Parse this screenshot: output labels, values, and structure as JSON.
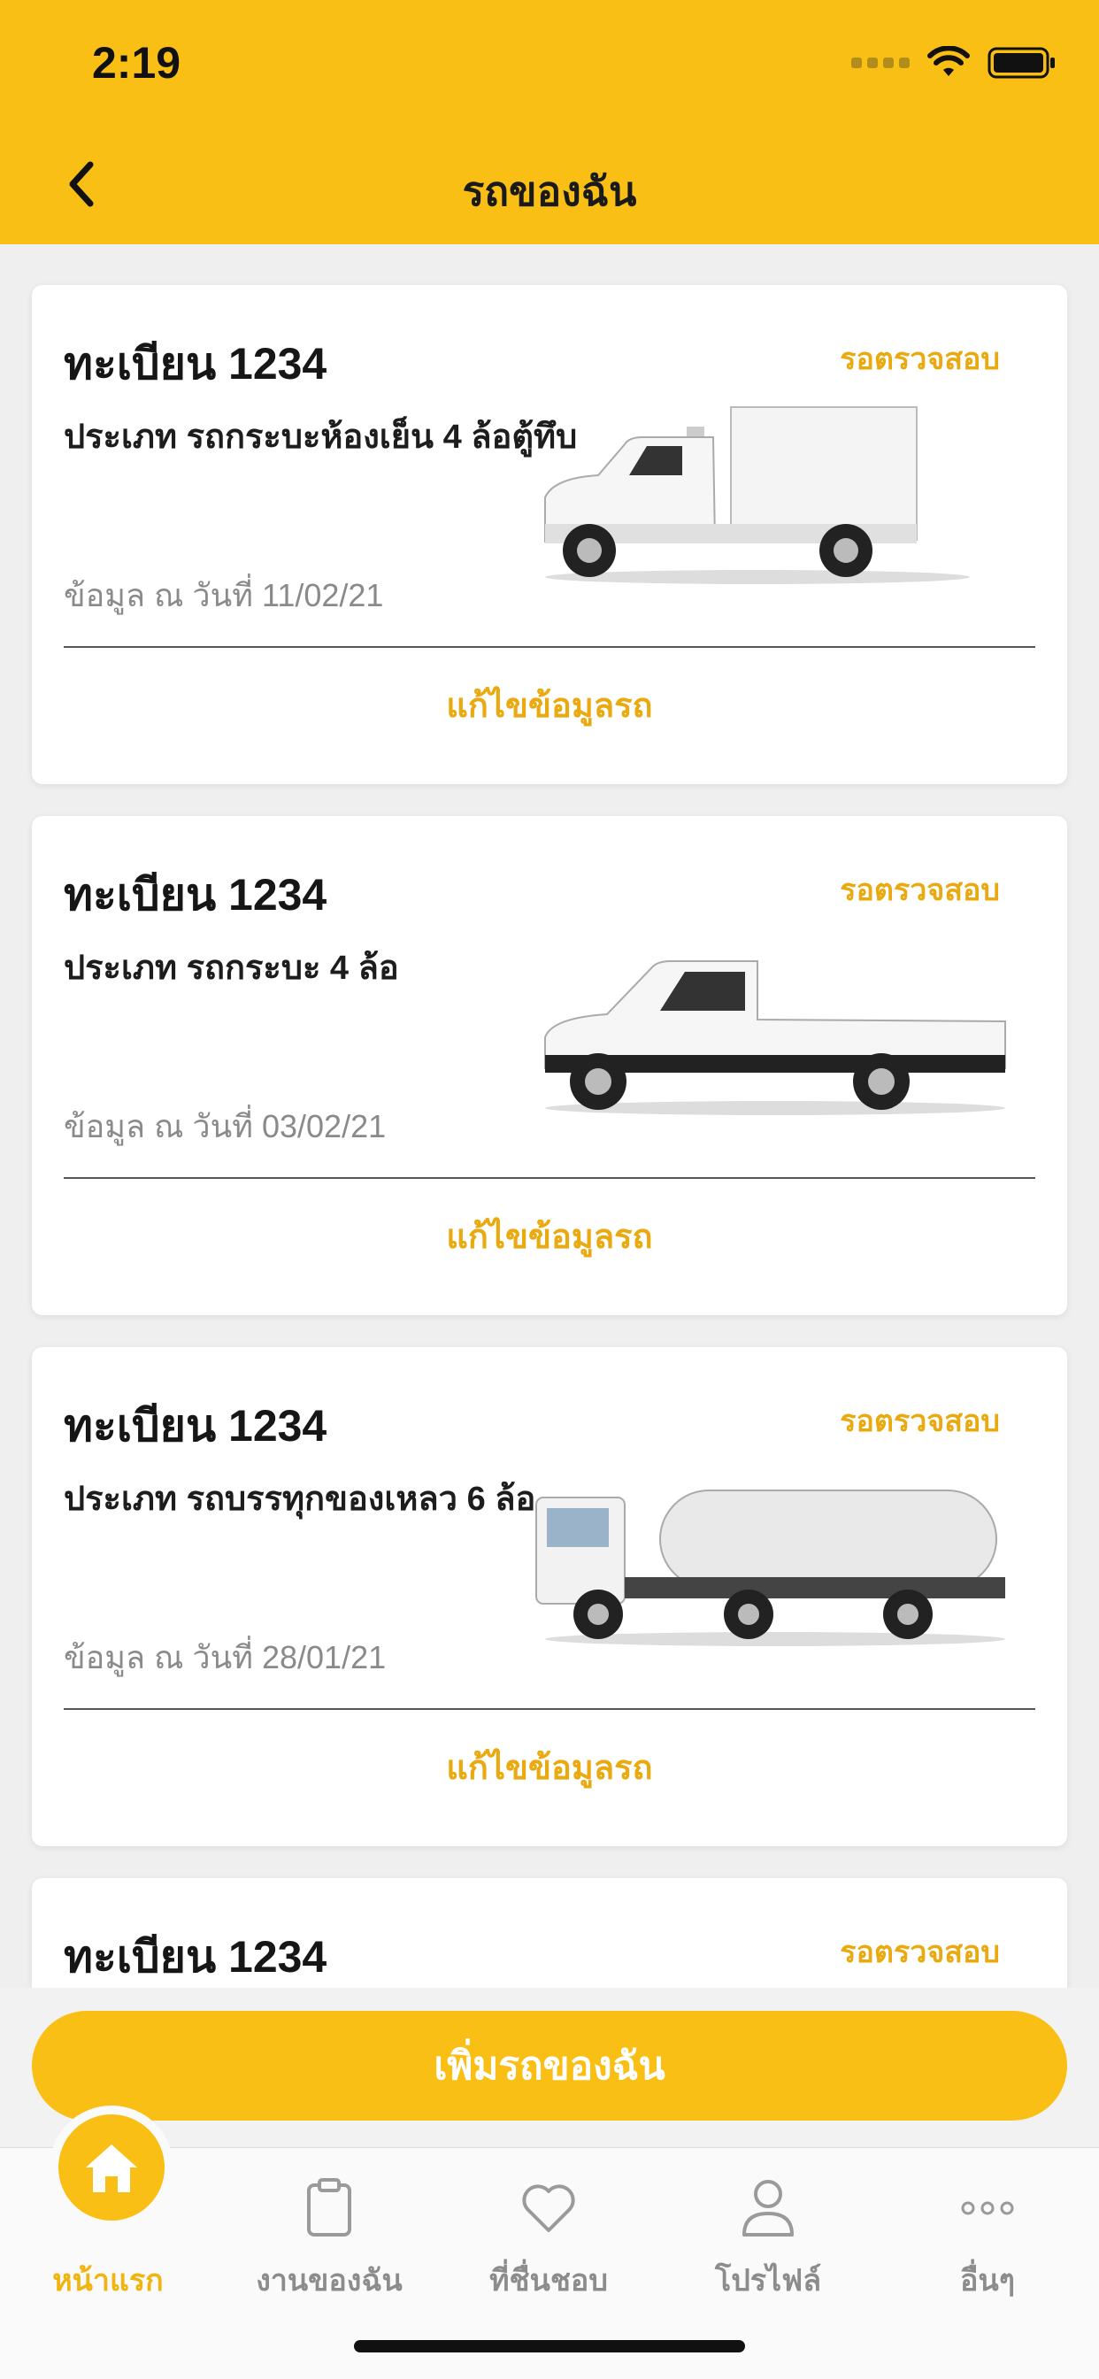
{
  "status_bar": {
    "time": "2:19"
  },
  "header": {
    "title": "รถของฉัน"
  },
  "cards": [
    {
      "title": "ทะเบียน 1234",
      "status": "รอตรวจสอบ",
      "type": "ประเภท  รถกระบะห้องเย็น 4 ล้อตู้ทึบ",
      "date": "ข้อมูล ณ วันที่ 11/02/21",
      "edit": "แก้ไขข้อมูลรถ",
      "vehicle": "refrigerated-pickup"
    },
    {
      "title": "ทะเบียน 1234",
      "status": "รอตรวจสอบ",
      "type": "ประเภท  รถกระบะ 4 ล้อ",
      "date": "ข้อมูล ณ วันที่ 03/02/21",
      "edit": "แก้ไขข้อมูลรถ",
      "vehicle": "pickup"
    },
    {
      "title": "ทะเบียน 1234",
      "status": "รอตรวจสอบ",
      "type": "ประเภท  รถบรรทุกของเหลว 6 ล้อ",
      "date": "ข้อมูล ณ วันที่ 28/01/21",
      "edit": "แก้ไขข้อมูลรถ",
      "vehicle": "tanker-truck"
    },
    {
      "title": "ทะเบียน 1234",
      "status": "รอตรวจสอบ"
    }
  ],
  "add_button": {
    "label": "เพิ่มรถของฉัน"
  },
  "tabbar": {
    "items": [
      {
        "label": "หน้าแรก",
        "icon": "home-icon",
        "active": true
      },
      {
        "label": "งานของฉัน",
        "icon": "clipboard-icon",
        "active": false
      },
      {
        "label": "ที่ชื่นชอบ",
        "icon": "heart-icon",
        "active": false
      },
      {
        "label": "โปรไฟล์",
        "icon": "user-icon",
        "active": false
      },
      {
        "label": "อื่นๆ",
        "icon": "more-icon",
        "active": false
      }
    ]
  },
  "colors": {
    "brand": "#f9bf14",
    "accent_text": "#e9a90f",
    "muted": "#8c8c8c"
  }
}
